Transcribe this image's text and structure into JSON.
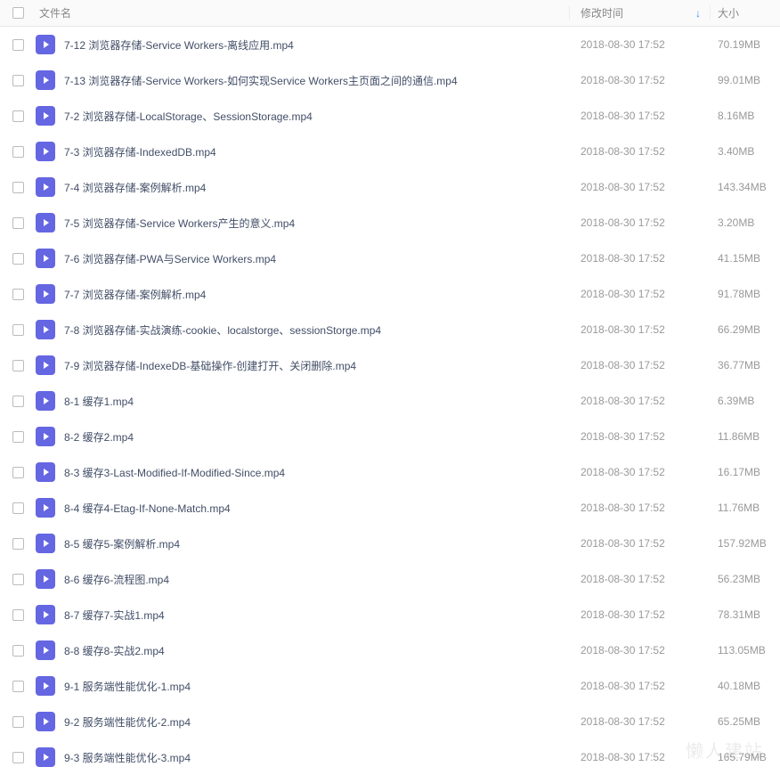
{
  "header": {
    "name": "文件名",
    "time": "修改时间",
    "size": "大小"
  },
  "watermark": "懒人建站",
  "files": [
    {
      "name": "7-12 浏览器存储-Service Workers-离线应用.mp4",
      "time": "2018-08-30 17:52",
      "size": "70.19MB"
    },
    {
      "name": "7-13 浏览器存储-Service Workers-如何实现Service Workers主页面之间的通信.mp4",
      "time": "2018-08-30 17:52",
      "size": "99.01MB"
    },
    {
      "name": "7-2 浏览器存储-LocalStorage、SessionStorage.mp4",
      "time": "2018-08-30 17:52",
      "size": "8.16MB"
    },
    {
      "name": "7-3 浏览器存储-IndexedDB.mp4",
      "time": "2018-08-30 17:52",
      "size": "3.40MB"
    },
    {
      "name": "7-4 浏览器存储-案例解析.mp4",
      "time": "2018-08-30 17:52",
      "size": "143.34MB"
    },
    {
      "name": "7-5 浏览器存储-Service Workers产生的意义.mp4",
      "time": "2018-08-30 17:52",
      "size": "3.20MB"
    },
    {
      "name": "7-6 浏览器存储-PWA与Service Workers.mp4",
      "time": "2018-08-30 17:52",
      "size": "41.15MB"
    },
    {
      "name": "7-7 浏览器存储-案例解析.mp4",
      "time": "2018-08-30 17:52",
      "size": "91.78MB"
    },
    {
      "name": "7-8 浏览器存储-实战演练-cookie、localstorge、sessionStorge.mp4",
      "time": "2018-08-30 17:52",
      "size": "66.29MB"
    },
    {
      "name": "7-9 浏览器存储-IndexeDB-基础操作-创建打开、关闭删除.mp4",
      "time": "2018-08-30 17:52",
      "size": "36.77MB"
    },
    {
      "name": "8-1 缓存1.mp4",
      "time": "2018-08-30 17:52",
      "size": "6.39MB"
    },
    {
      "name": "8-2 缓存2.mp4",
      "time": "2018-08-30 17:52",
      "size": "11.86MB"
    },
    {
      "name": "8-3 缓存3-Last-Modified-If-Modified-Since.mp4",
      "time": "2018-08-30 17:52",
      "size": "16.17MB"
    },
    {
      "name": "8-4 缓存4-Etag-If-None-Match.mp4",
      "time": "2018-08-30 17:52",
      "size": "11.76MB"
    },
    {
      "name": "8-5 缓存5-案例解析.mp4",
      "time": "2018-08-30 17:52",
      "size": "157.92MB"
    },
    {
      "name": "8-6 缓存6-流程图.mp4",
      "time": "2018-08-30 17:52",
      "size": "56.23MB"
    },
    {
      "name": "8-7 缓存7-实战1.mp4",
      "time": "2018-08-30 17:52",
      "size": "78.31MB"
    },
    {
      "name": "8-8 缓存8-实战2.mp4",
      "time": "2018-08-30 17:52",
      "size": "113.05MB"
    },
    {
      "name": "9-1 服务端性能优化-1.mp4",
      "time": "2018-08-30 17:52",
      "size": "40.18MB"
    },
    {
      "name": "9-2 服务端性能优化-2.mp4",
      "time": "2018-08-30 17:52",
      "size": "65.25MB"
    },
    {
      "name": "9-3 服务端性能优化-3.mp4",
      "time": "2018-08-30 17:52",
      "size": "165.79MB"
    }
  ]
}
